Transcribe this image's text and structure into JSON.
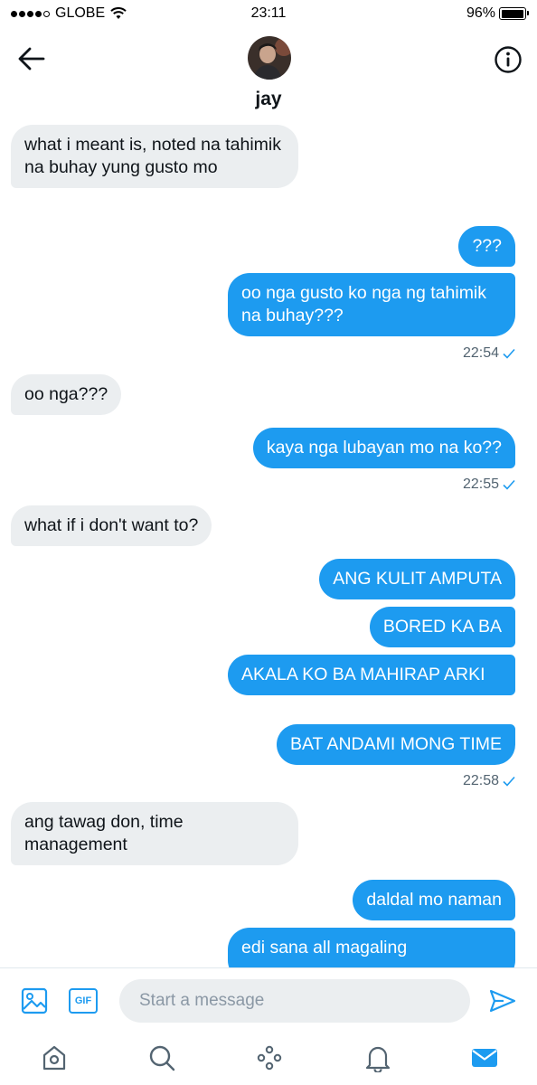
{
  "status": {
    "carrier": "GLOBE",
    "time": "23:11",
    "battery": "96%",
    "battery_level": 0.96
  },
  "header": {
    "name": "jay"
  },
  "messages": [
    {
      "dir": "in",
      "text": "what i meant is, noted na tahimik na buhay yung gusto mo"
    },
    {
      "dir": "out",
      "text": "???"
    },
    {
      "dir": "out",
      "text": "oo nga gusto ko nga ng tahimik na buhay???"
    },
    {
      "stamp": "22:54"
    },
    {
      "dir": "in",
      "text": "oo nga???"
    },
    {
      "dir": "out",
      "text": "kaya nga lubayan mo na ko??"
    },
    {
      "stamp": "22:55"
    },
    {
      "dir": "in",
      "text": "what if i don't want to?"
    },
    {
      "dir": "out",
      "text": "ANG KULIT AMPUTA"
    },
    {
      "dir": "out",
      "text": "BORED KA BA"
    },
    {
      "dir": "out",
      "text": "AKALA KO BA MAHIRAP ARKI"
    },
    {
      "dir": "out",
      "text": "BAT ANDAMI MONG TIME"
    },
    {
      "stamp": "22:58"
    },
    {
      "dir": "in",
      "text": "ang tawag don, time management"
    },
    {
      "dir": "out",
      "text": "daldal mo naman"
    },
    {
      "dir": "out",
      "text": "edi sana all magaling"
    }
  ],
  "composer": {
    "placeholder": "Start a message",
    "gif_label": "GIF"
  },
  "colors": {
    "accent": "#1d9bf0",
    "incoming_bg": "#ebeef0",
    "muted": "#536471"
  }
}
